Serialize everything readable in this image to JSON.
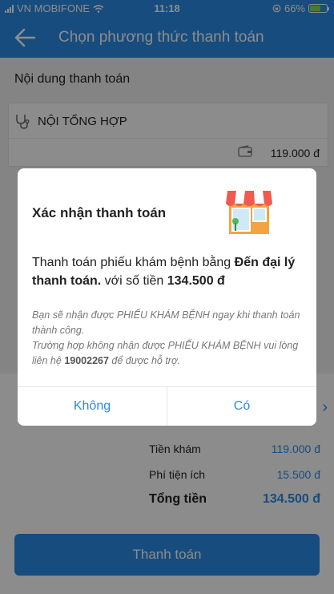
{
  "status_bar": {
    "carrier": "VN MOBIFONE",
    "time": "11:18",
    "battery": "66%",
    "battery_level": 0.66
  },
  "header": {
    "title": "Chọn phương thức thanh toán"
  },
  "payment_content": {
    "title": "Nội dung thanh toán",
    "service_name": "NỘI TỔNG HỢP",
    "service_price": "119.000 đ"
  },
  "summary": {
    "rows": [
      {
        "label": "Tiền khám",
        "value": "119.000 đ"
      },
      {
        "label": "Phí tiện ích",
        "value": "15.500 đ"
      }
    ],
    "total_label": "Tổng tiền",
    "total_value": "134.500 đ"
  },
  "pay_button": "Thanh toán",
  "dialog": {
    "title": "Xác nhận thanh toán",
    "msg_pre": "Thanh toán phiếu khám bệnh bằng ",
    "msg_method": "Đến đại lý thanh toán.",
    "msg_mid": " với số tiền ",
    "msg_amount": "134.500 đ",
    "note_line1": "Bạn sẽ nhận được PHIẾU KHÁM BỆNH ngay khi thanh toán thành công.",
    "note_line2_pre": "Trường hợp không nhận được PHIẾU KHÁM BỆNH vui lòng liên hệ ",
    "hotline": "19002267",
    "note_line2_post": " để được hỗ trợ.",
    "no_label": "Không",
    "yes_label": "Có"
  },
  "colors": {
    "primary": "#2a8be6",
    "overlay": "rgba(0,0,0,0.45)"
  }
}
